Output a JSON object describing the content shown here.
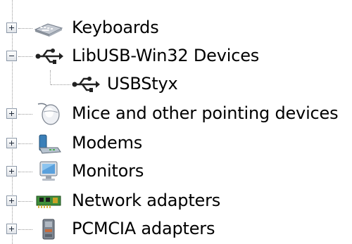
{
  "tree": {
    "items": [
      {
        "label": "Keyboards",
        "state": "collapsed",
        "icon": "keyboard-icon"
      },
      {
        "label": "LibUSB-Win32 Devices",
        "state": "expanded",
        "icon": "usb-icon",
        "children": [
          {
            "label": "USBStyx",
            "icon": "usb-icon"
          }
        ]
      },
      {
        "label": "Mice and other pointing devices",
        "state": "collapsed",
        "icon": "mouse-icon"
      },
      {
        "label": "Modems",
        "state": "collapsed",
        "icon": "modem-icon"
      },
      {
        "label": "Monitors",
        "state": "collapsed",
        "icon": "monitor-icon"
      },
      {
        "label": "Network adapters",
        "state": "collapsed",
        "icon": "network-adapter-icon"
      },
      {
        "label": "PCMCIA adapters",
        "state": "collapsed",
        "icon": "pcmcia-icon"
      }
    ]
  },
  "colors": {
    "connector": "#9a9a9a",
    "toggle_border": "#8c98a8",
    "text": "#000000",
    "background": "#ffffff"
  }
}
